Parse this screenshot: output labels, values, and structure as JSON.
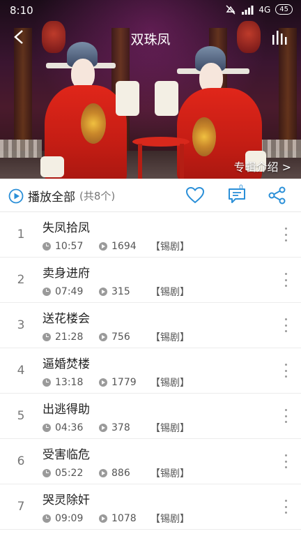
{
  "status": {
    "time": "8:10",
    "network": "4G",
    "battery": "45"
  },
  "header": {
    "title": "双珠凤",
    "album_intro": "专辑介绍 >"
  },
  "toolbar": {
    "play_all_label": "播放全部",
    "track_count": "(共8个)",
    "comment_count": "0"
  },
  "tracks": [
    {
      "index": "1",
      "title": "失凤拾凤",
      "duration": "10:57",
      "plays": "1694",
      "tag": "【锡剧】"
    },
    {
      "index": "2",
      "title": "卖身进府",
      "duration": "07:49",
      "plays": "315",
      "tag": "【锡剧】"
    },
    {
      "index": "3",
      "title": "送花楼会",
      "duration": "21:28",
      "plays": "756",
      "tag": "【锡剧】"
    },
    {
      "index": "4",
      "title": "逼婚焚楼",
      "duration": "13:18",
      "plays": "1779",
      "tag": "【锡剧】"
    },
    {
      "index": "5",
      "title": "出逃得助",
      "duration": "04:36",
      "plays": "378",
      "tag": "【锡剧】"
    },
    {
      "index": "6",
      "title": "受害临危",
      "duration": "05:22",
      "plays": "886",
      "tag": "【锡剧】"
    },
    {
      "index": "7",
      "title": "哭灵除奸",
      "duration": "09:09",
      "plays": "1078",
      "tag": "【锡剧】"
    }
  ],
  "colors": {
    "accent": "#2a8fd8",
    "robe": "#d9261a"
  },
  "icons": {
    "back": "back-arrow-icon",
    "equalizer": "equalizer-icon",
    "favorite": "heart-icon",
    "comment": "comment-icon",
    "share": "share-icon",
    "more": "more-vertical-icon"
  }
}
